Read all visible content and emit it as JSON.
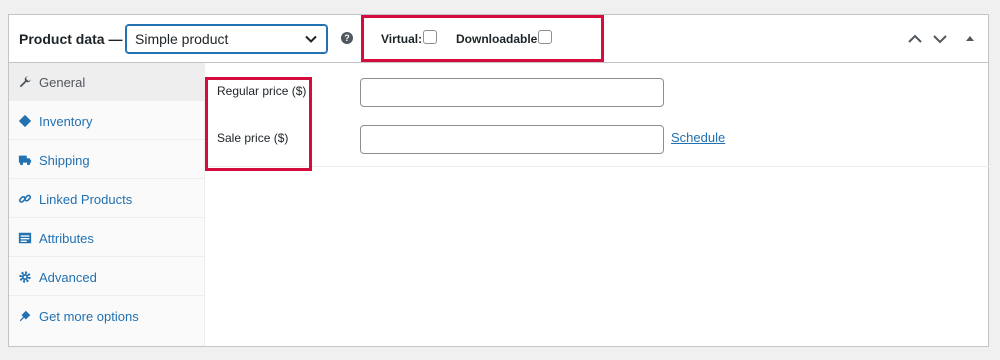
{
  "header": {
    "title": "Product data —",
    "product_type": "Simple product",
    "help_glyph": "?",
    "virtual_label": "Virtual:",
    "downloadable_label": "Downloadable:",
    "icons": [
      "chevron-up-icon",
      "chevron-down-icon",
      "collapse-triangle-icon"
    ]
  },
  "sidebar": {
    "items": [
      {
        "label": "General",
        "icon": "wrench-icon",
        "active": true
      },
      {
        "label": "Inventory",
        "icon": "tag-icon"
      },
      {
        "label": "Shipping",
        "icon": "truck-icon"
      },
      {
        "label": "Linked Products",
        "icon": "link-icon"
      },
      {
        "label": "Attributes",
        "icon": "list-icon"
      },
      {
        "label": "Advanced",
        "icon": "gear-icon"
      },
      {
        "label": "Get more options",
        "icon": "plugin-icon"
      }
    ]
  },
  "general": {
    "regular_price_label": "Regular price ($)",
    "regular_price_value": "",
    "sale_price_label": "Sale price ($)",
    "sale_price_value": "",
    "schedule_link": "Schedule"
  },
  "colors": {
    "accent": "#2271b1",
    "highlight": "#d40d3d",
    "text": "#1d2327"
  }
}
